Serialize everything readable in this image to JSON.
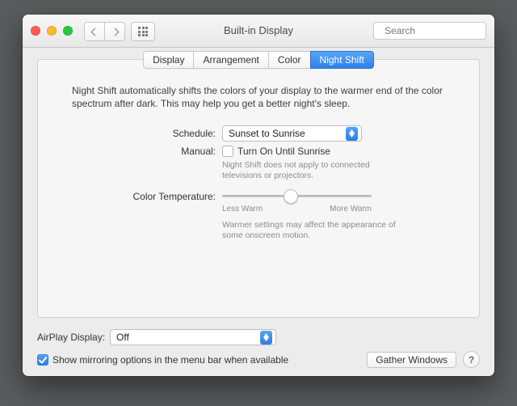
{
  "window": {
    "title": "Built-in Display"
  },
  "search": {
    "placeholder": "Search"
  },
  "tabs": [
    "Display",
    "Arrangement",
    "Color",
    "Night Shift"
  ],
  "intro": "Night Shift automatically shifts the colors of your display to the warmer end of the color spectrum after dark. This may help you get a better night's sleep.",
  "schedule": {
    "label": "Schedule:",
    "value": "Sunset to Sunrise"
  },
  "manual": {
    "label": "Manual:",
    "checkbox_label": "Turn On Until Sunrise",
    "hint": "Night Shift does not apply to connected televisions or projectors."
  },
  "temperature": {
    "label": "Color Temperature:",
    "min_label": "Less Warm",
    "max_label": "More Warm",
    "hint": "Warmer settings may affect the appearance of some onscreen motion."
  },
  "airplay": {
    "label": "AirPlay Display:",
    "value": "Off"
  },
  "mirroring": {
    "label": "Show mirroring options in the menu bar when available"
  },
  "buttons": {
    "gather": "Gather Windows"
  },
  "help_glyph": "?",
  "colors": {
    "close": "#fc5b53",
    "min": "#fdbb2b",
    "zoom": "#29c73d"
  }
}
